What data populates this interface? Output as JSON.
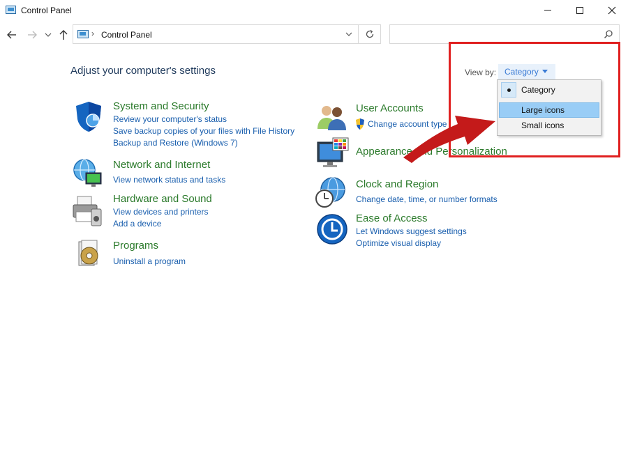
{
  "window": {
    "title": "Control Panel"
  },
  "address_bar": {
    "path": "Control Panel",
    "separator": "›"
  },
  "search": {
    "placeholder": ""
  },
  "main": {
    "heading": "Adjust your computer's settings",
    "view_by_label": "View by:",
    "view_by_value": "Category"
  },
  "categories": [
    {
      "title": "System and Security",
      "links": [
        "Review your computer's status",
        "Save backup copies of your files with File History",
        "Backup and Restore (Windows 7)"
      ],
      "icon": "shield-icon"
    },
    {
      "title": "Network and Internet",
      "links": [
        "View network status and tasks"
      ],
      "icon": "network-globe-icon"
    },
    {
      "title": "Hardware and Sound",
      "links": [
        "View devices and printers",
        "Add a device"
      ],
      "icon": "printer-icon"
    },
    {
      "title": "Programs",
      "links": [
        "Uninstall a program"
      ],
      "icon": "programs-disc-icon"
    },
    {
      "title": "User Accounts",
      "links": [
        "Change account type"
      ],
      "icon": "users-icon"
    },
    {
      "title": "Appearance and Personalization",
      "links": [],
      "icon": "monitor-palette-icon"
    },
    {
      "title": "Clock and Region",
      "links": [
        "Change date, time, or number formats"
      ],
      "icon": "clock-globe-icon"
    },
    {
      "title": "Ease of Access",
      "links": [
        "Let Windows suggest settings",
        "Optimize visual display"
      ],
      "icon": "ease-of-access-icon"
    }
  ],
  "view_menu": {
    "items": [
      {
        "label": "Category",
        "selected": true
      },
      {
        "label": "Large icons",
        "hovered": true
      },
      {
        "label": "Small icons"
      }
    ]
  },
  "colors": {
    "category_title": "#2b7a2b",
    "link": "#1a5fae",
    "annotation": "#e02020",
    "menu_highlight": "#99cdf6"
  }
}
